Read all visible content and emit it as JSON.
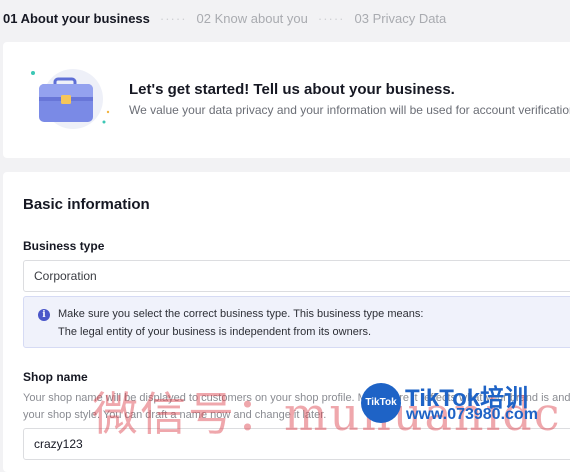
{
  "stepper": {
    "steps": [
      {
        "label": "01 About your business",
        "state": "active"
      },
      {
        "label": "02 Know about you",
        "state": "inactive"
      },
      {
        "label": "03 Privacy Data",
        "state": "inactive"
      }
    ],
    "separator": "·····"
  },
  "hero": {
    "illustration_icon": "briefcase-icon",
    "title": "Let's get started! Tell us about your business.",
    "subtitle": "We value your data privacy and your information will be used for account verification"
  },
  "form": {
    "section_title": "Basic information",
    "business_type": {
      "label": "Business type",
      "value": "Corporation"
    },
    "info_notice": {
      "icon": "info-icon",
      "icon_glyph": "i",
      "line1": "Make sure you select the correct business type. This business type means:",
      "line2": "The legal entity of your business is independent from its owners."
    },
    "shop_name": {
      "label": "Shop name",
      "helper": "Your shop name will be displayed to customers on your shop profile. Make sure it reflects what your brand is and your shop style. You can draft a name now and change it later.",
      "value": "crazy123"
    }
  },
  "watermark": {
    "chinese_text": "微信号：muhuanidc",
    "logo_text": "TikTok",
    "brand_text": "TikTok培训",
    "url_text": "www.073980.com"
  },
  "colors": {
    "page_bg": "#f2f2f4",
    "card_bg": "#ffffff",
    "accent_blue": "#4a56c9",
    "info_bg": "#f0f2fb",
    "watermark_red": "#dc3c46",
    "watermark_blue": "#1e63c6"
  }
}
